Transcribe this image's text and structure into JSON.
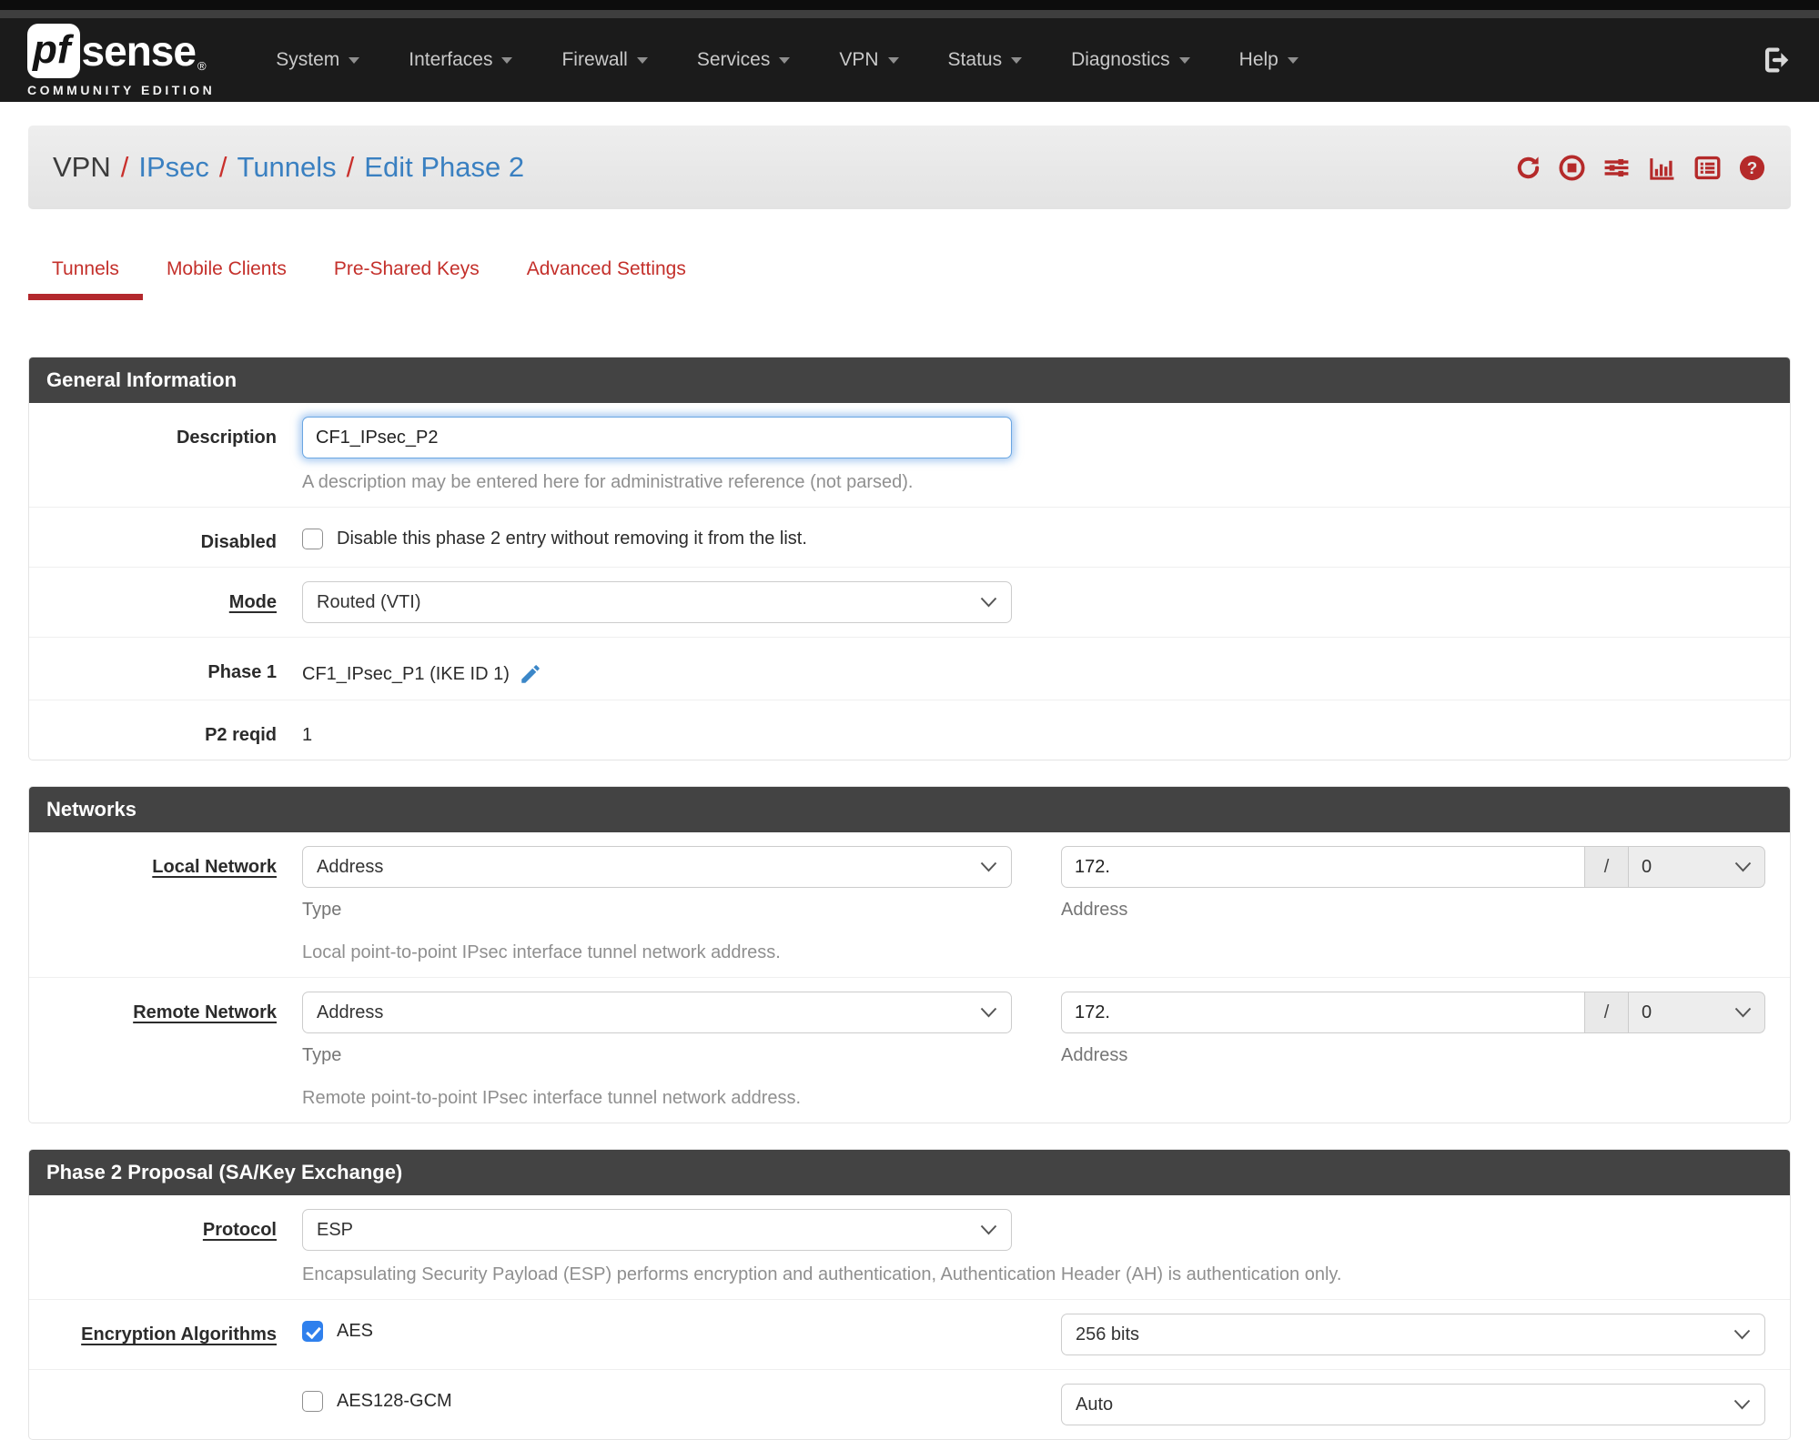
{
  "colors": {
    "accent_red": "#c9302c",
    "link_blue": "#3a80c1",
    "navbar_bg": "#1b1b1b",
    "section_header_bg": "#434343",
    "checkbox_blue": "#2f80ed",
    "tab_red": "#c4302b"
  },
  "navbar": {
    "brand": {
      "pf": "pf",
      "sense": "sense",
      "trademark": "®",
      "edition": "COMMUNITY EDITION"
    },
    "items": [
      {
        "label": "System"
      },
      {
        "label": "Interfaces"
      },
      {
        "label": "Firewall"
      },
      {
        "label": "Services"
      },
      {
        "label": "VPN"
      },
      {
        "label": "Status"
      },
      {
        "label": "Diagnostics"
      },
      {
        "label": "Help"
      }
    ],
    "logout_icon": "sign-out-icon"
  },
  "breadcrumb": {
    "separator": "/",
    "items": [
      {
        "label": "VPN"
      },
      {
        "label": "IPsec"
      },
      {
        "label": "Tunnels"
      },
      {
        "label": "Edit Phase 2"
      }
    ],
    "action_icons": [
      "refresh-icon",
      "stop-icon",
      "sliders-icon",
      "bar-chart-icon",
      "log-icon",
      "help-icon"
    ]
  },
  "tabs": [
    {
      "label": "Tunnels",
      "active": true
    },
    {
      "label": "Mobile Clients",
      "active": false
    },
    {
      "label": "Pre-Shared Keys",
      "active": false
    },
    {
      "label": "Advanced Settings",
      "active": false
    }
  ],
  "general": {
    "title": "General Information",
    "description": {
      "label": "Description",
      "value": "CF1_IPsec_P2",
      "help": "A description may be entered here for administrative reference (not parsed)."
    },
    "disabled": {
      "label": "Disabled",
      "checkbox_label": "Disable this phase 2 entry without removing it from the list.",
      "checked": false
    },
    "mode": {
      "label": "Mode",
      "value": "Routed (VTI)"
    },
    "phase1": {
      "label": "Phase 1",
      "value": "CF1_IPsec_P1 (IKE ID 1)"
    },
    "p2reqid": {
      "label": "P2 reqid",
      "value": "1"
    }
  },
  "networks": {
    "title": "Networks",
    "local": {
      "label": "Local Network",
      "type_value": "Address",
      "type_caption": "Type",
      "address_value": "172.",
      "address_caption": "Address",
      "slash": "/",
      "prefix_value": "0",
      "help": "Local point-to-point IPsec interface tunnel network address."
    },
    "remote": {
      "label": "Remote Network",
      "type_value": "Address",
      "type_caption": "Type",
      "address_value": "172.",
      "address_caption": "Address",
      "slash": "/",
      "prefix_value": "0",
      "help": "Remote point-to-point IPsec interface tunnel network address."
    }
  },
  "proposal": {
    "title": "Phase 2 Proposal (SA/Key Exchange)",
    "protocol": {
      "label": "Protocol",
      "value": "ESP",
      "help": "Encapsulating Security Payload (ESP) performs encryption and authentication, Authentication Header (AH) is authentication only."
    },
    "encryption": {
      "label": "Encryption Algorithms",
      "algorithms": [
        {
          "name": "AES",
          "checked": true,
          "key_length": "256 bits"
        },
        {
          "name": "AES128-GCM",
          "checked": false,
          "key_length": "Auto"
        }
      ]
    }
  }
}
